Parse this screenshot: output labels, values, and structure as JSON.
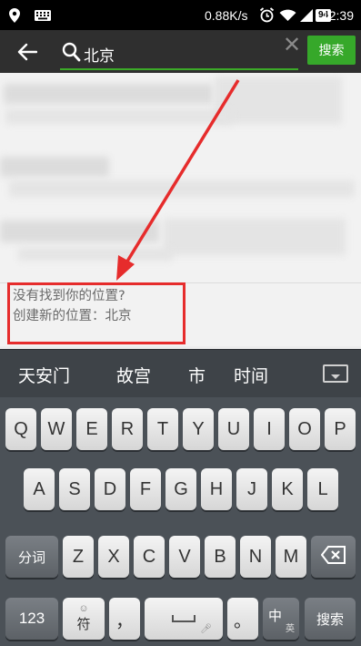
{
  "status_bar": {
    "speed": "0.88K/s",
    "battery": "94",
    "time": "12:39"
  },
  "search": {
    "query": "北京",
    "button_label": "搜索",
    "accent_color": "#36a82a"
  },
  "result": {
    "not_found": "没有找到你的位置?",
    "create_new": "创建新的位置：北京",
    "highlight_color": "#e62c2c"
  },
  "candidates": [
    "天安门",
    "故宫",
    "市",
    "时间"
  ],
  "keyboard": {
    "row1": [
      "Q",
      "W",
      "E",
      "R",
      "T",
      "Y",
      "U",
      "I",
      "O",
      "P"
    ],
    "row2": [
      "A",
      "S",
      "D",
      "F",
      "G",
      "H",
      "J",
      "K",
      "L"
    ],
    "row3": [
      "Z",
      "X",
      "C",
      "V",
      "B",
      "N",
      "M"
    ],
    "fenci": "分词",
    "num": "123",
    "symbol": "符",
    "comma": "，",
    "period": "。",
    "zhong": "中",
    "ying": "英",
    "search": "搜索"
  }
}
